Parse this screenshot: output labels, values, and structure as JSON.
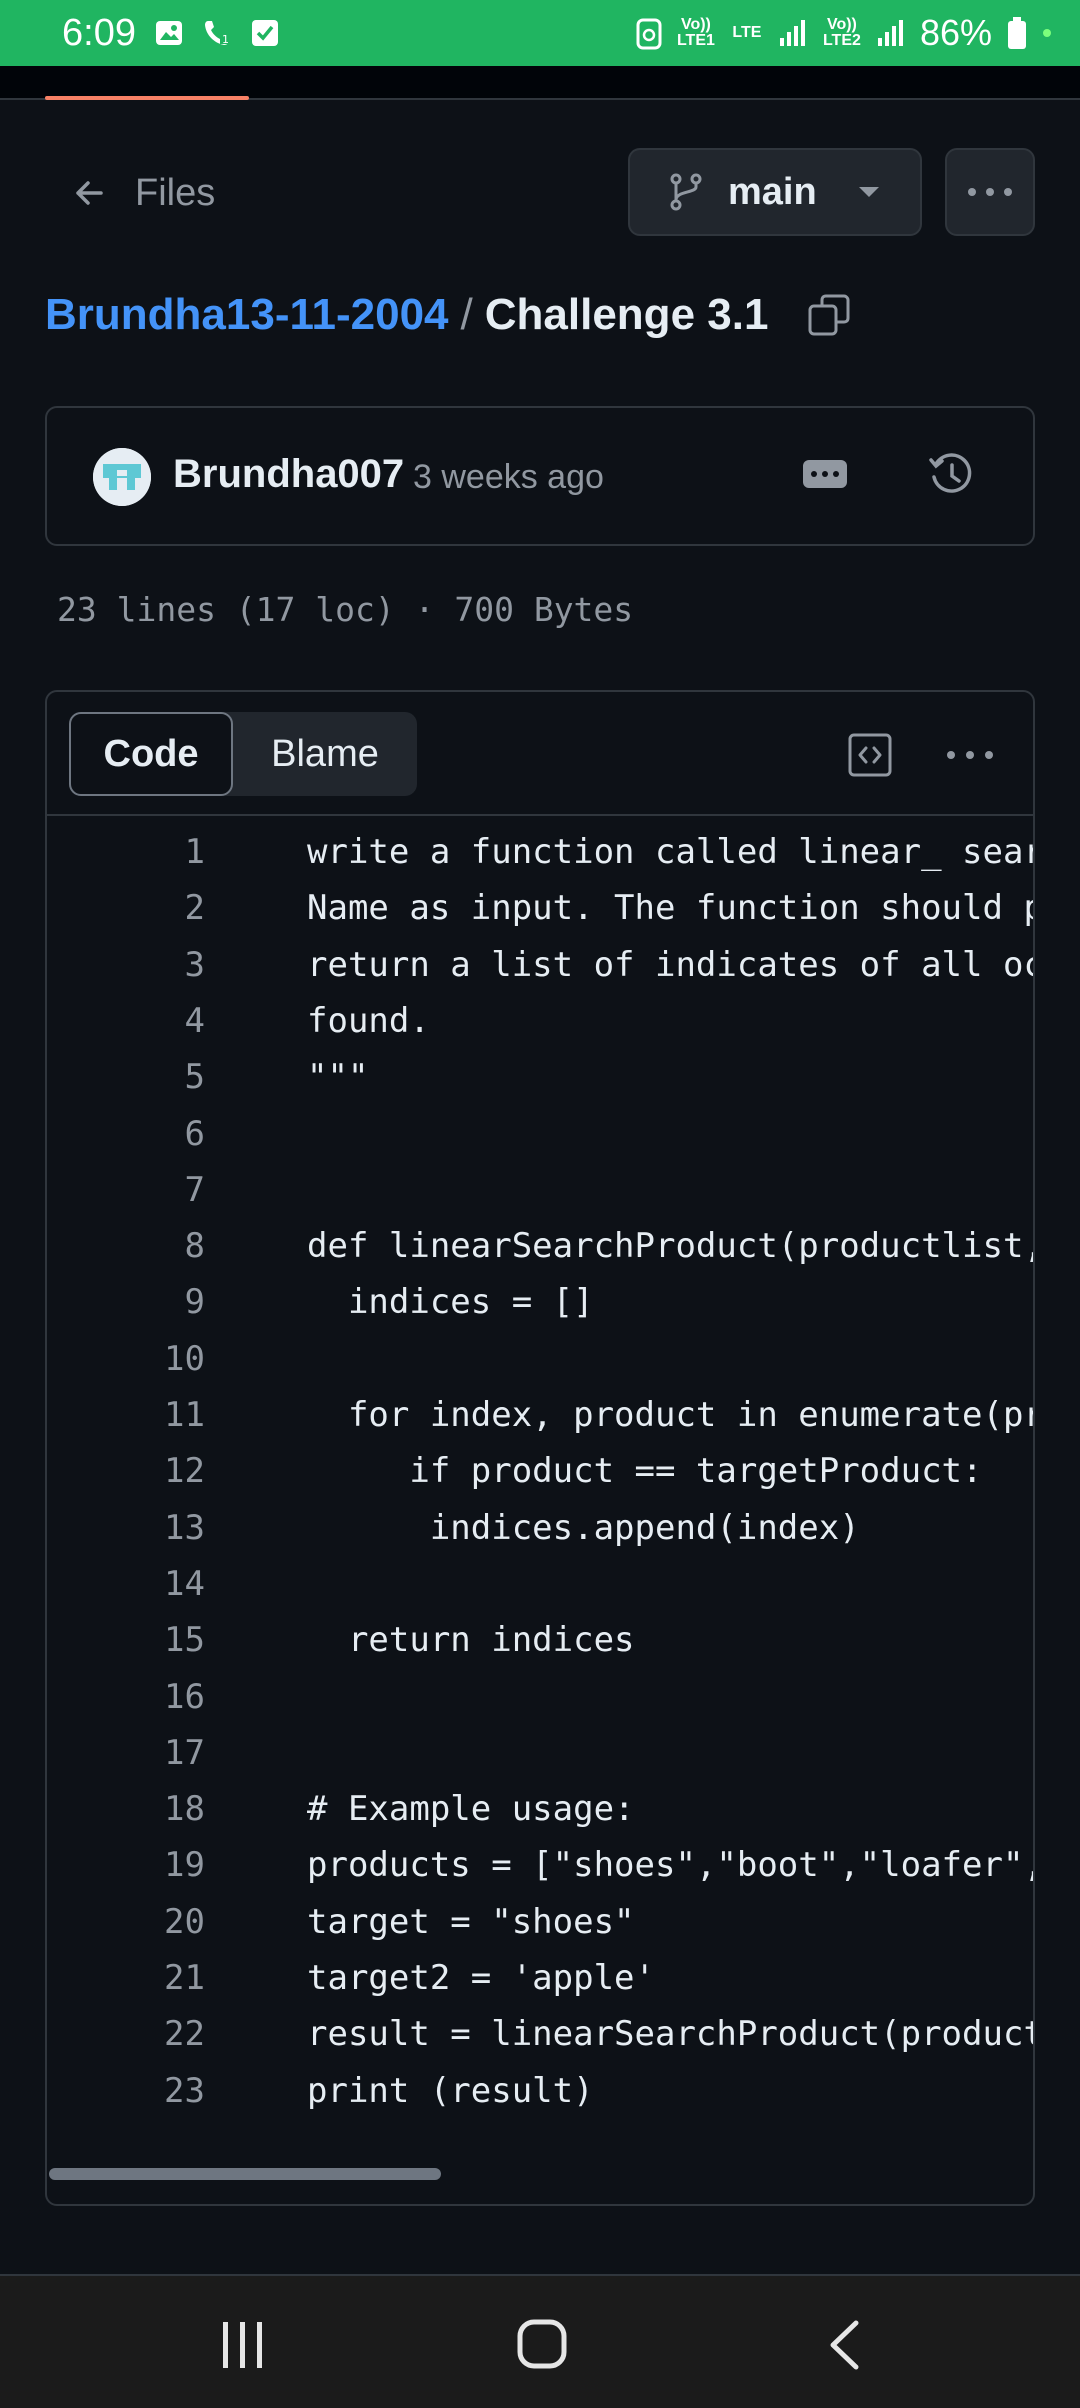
{
  "status_bar": {
    "time": "6:09",
    "lte1_label": "Vo)) LTE1",
    "lte_label": "LTE",
    "lte2_label": "Vo)) LTE2",
    "battery": "86%"
  },
  "nav": {
    "back_label": "Files",
    "branch": "main"
  },
  "breadcrumb": {
    "owner": "Brundha13-11-2004",
    "separator": "/",
    "repo": "Challenge 3.1"
  },
  "commit": {
    "author": "Brundha007",
    "time_ago": "3 weeks ago"
  },
  "file_info": "23 lines (17 loc) · 700 Bytes",
  "tabs": {
    "code_label": "Code",
    "blame_label": "Blame"
  },
  "code": {
    "lines": [
      {
        "n": "1",
        "t": "write a function called linear_ search_product that takes the list of products and a target Product"
      },
      {
        "n": "2",
        "t": "Name as input. The function should perform a linear search to find the target product in the list and"
      },
      {
        "n": "3",
        "t": "return a list of indicates of all occurrences of the product if found, or an empty list if not"
      },
      {
        "n": "4",
        "t": "found."
      },
      {
        "n": "5",
        "t": "\"\"\""
      },
      {
        "n": "6",
        "t": ""
      },
      {
        "n": "7",
        "t": ""
      },
      {
        "n": "8",
        "t": "def linearSearchProduct(productlist, targetProduct):"
      },
      {
        "n": "9",
        "t": "  indices = []"
      },
      {
        "n": "10",
        "t": ""
      },
      {
        "n": "11",
        "t": "  for index, product in enumerate(productlist):"
      },
      {
        "n": "12",
        "t": "     if product == targetProduct:"
      },
      {
        "n": "13",
        "t": "      indices.append(index)"
      },
      {
        "n": "14",
        "t": ""
      },
      {
        "n": "15",
        "t": "  return indices"
      },
      {
        "n": "16",
        "t": ""
      },
      {
        "n": "17",
        "t": ""
      },
      {
        "n": "18",
        "t": "# Example usage:"
      },
      {
        "n": "19",
        "t": "products = [\"shoes\",\"boot\",\"loafer\",\"shoes\",\"sandal\",\"shoes\"]"
      },
      {
        "n": "20",
        "t": "target = \"shoes\""
      },
      {
        "n": "21",
        "t": "target2 = 'apple'"
      },
      {
        "n": "22",
        "t": "result = linearSearchProduct(products, target)"
      },
      {
        "n": "23",
        "t": "print (result)"
      }
    ]
  },
  "icons": [
    "image-icon",
    "call-icon",
    "check-icon",
    "arrow-left-icon",
    "git-branch-icon",
    "caret-down-icon",
    "kebab-icon",
    "copy-icon",
    "history-icon",
    "code-square-icon",
    "recent-apps-icon",
    "home-icon",
    "back-icon"
  ]
}
